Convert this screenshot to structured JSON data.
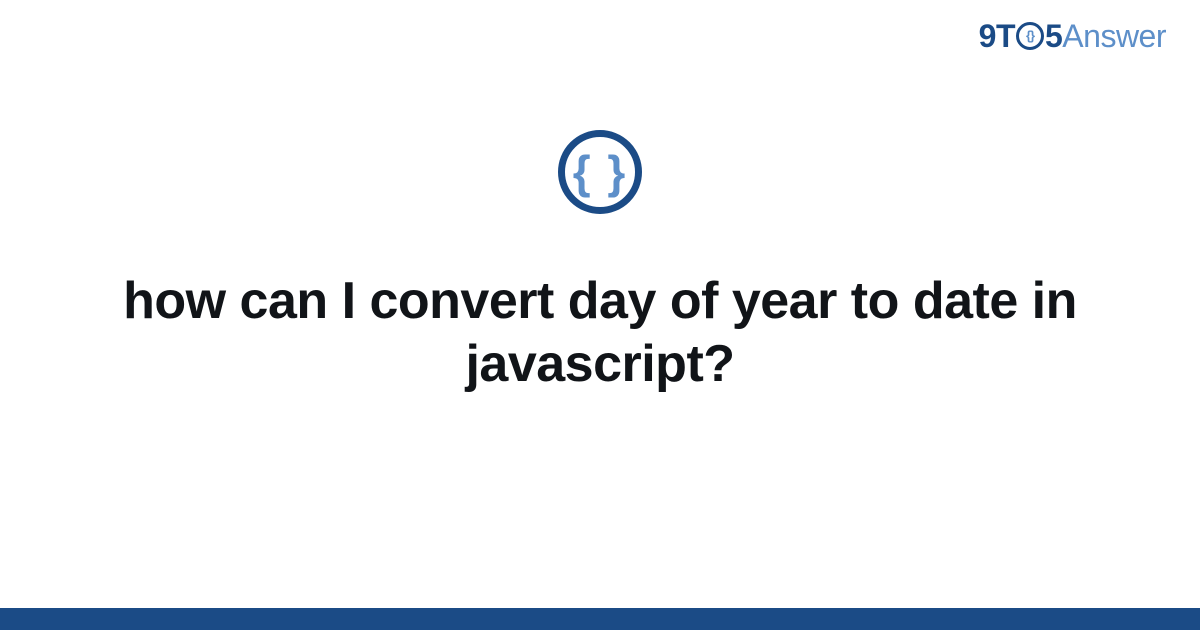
{
  "brand": {
    "part1": "9T",
    "inner_braces": "{}",
    "part2": "5",
    "part3": "Answer"
  },
  "icon": {
    "braces": "{ }"
  },
  "title": "how can I convert day of year to date in javascript?",
  "colors": {
    "accent_dark": "#1b4b86",
    "accent_light": "#5d8fc9"
  }
}
